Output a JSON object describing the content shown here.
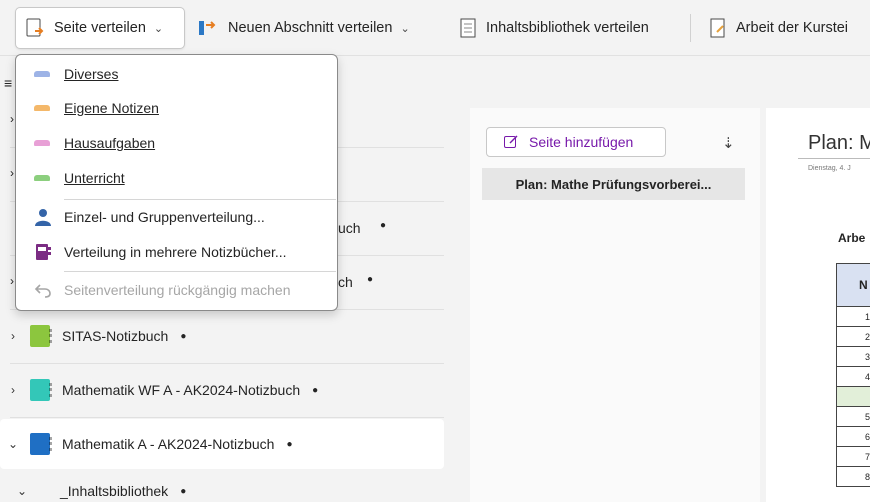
{
  "ribbon": {
    "distribute_page": "Seite verteilen",
    "distribute_section": "Neuen Abschnitt verteilen",
    "distribute_library": "Inhaltsbibliothek verteilen",
    "student_work": "Arbeit der Kurstei"
  },
  "menu": {
    "items": [
      {
        "label": "Diverses",
        "color": "#9db3e6"
      },
      {
        "label": "Eigene Notizen",
        "color": "#f4b86a"
      },
      {
        "label": "Hausaufgaben",
        "color": "#e8a0d6"
      },
      {
        "label": "Unterricht",
        "color": "#8ccf7e"
      },
      {
        "label": "Einzel- und Gruppenverteilung..."
      },
      {
        "label": "Verteilung in mehrere Notizbücher..."
      },
      {
        "label": "Seitenverteilung rückgängig machen",
        "disabled": true
      }
    ]
  },
  "sidebar": {
    "partial1": "uch",
    "partial2": "ch",
    "notebooks": [
      {
        "name": "SITAS-Notizbuch",
        "color": "#8cc63e"
      },
      {
        "name": "Mathematik WF A - AK2024-Notizbuch",
        "color": "#33c7b8"
      },
      {
        "name": "Mathematik A - AK2024-Notizbuch",
        "color": "#1f6fc4"
      }
    ],
    "section": "_Inhaltsbibliothek",
    "dot": "●"
  },
  "pagelist": {
    "add_page": "Seite hinzufügen",
    "page_title": "Plan: Mathe Prüfungsvorberei..."
  },
  "canvas": {
    "title": "Plan: M",
    "date": "Dienstag, 4. J",
    "heading": "Arbe",
    "table_header": "N",
    "rows": [
      "1",
      "2",
      "3",
      "4",
      "",
      "5",
      "6",
      "7",
      "8"
    ]
  }
}
